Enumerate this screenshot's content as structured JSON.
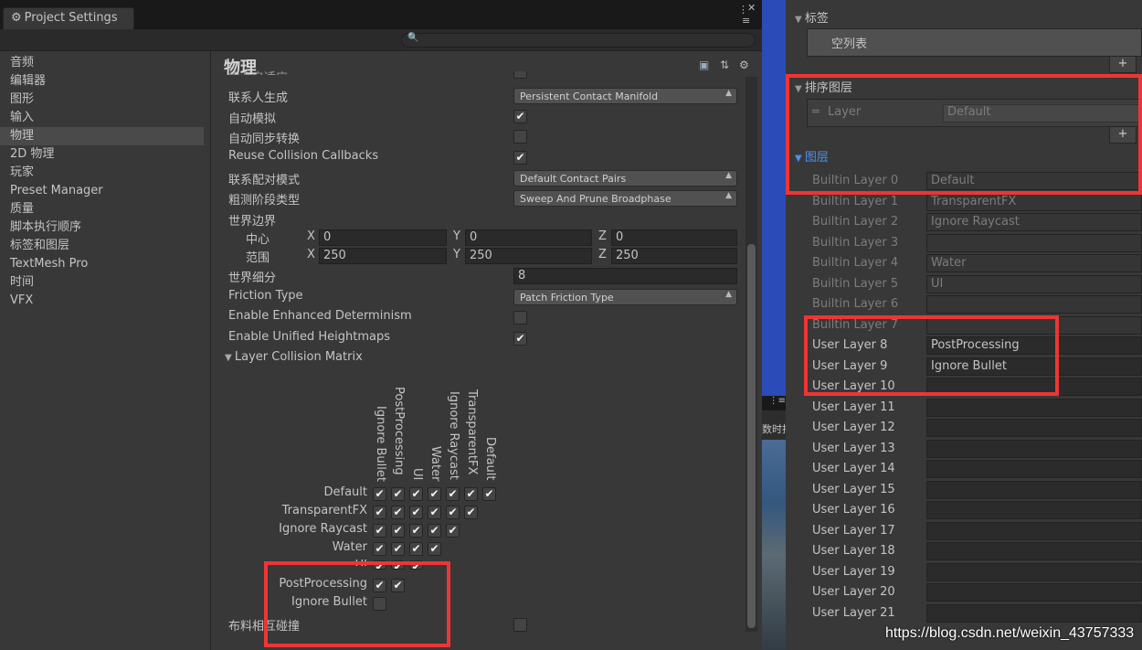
{
  "window": {
    "title": "Project Settings",
    "search_placeholder": ""
  },
  "sidebar": {
    "items": [
      "音频",
      "编辑器",
      "图形",
      "输入",
      "物理",
      "2D 物理",
      "玩家",
      "Preset Manager",
      "质量",
      "脚本执行顺序",
      "标签和图层",
      "TextMesh Pro",
      "时间",
      "VFX"
    ],
    "selected": "物理"
  },
  "physics": {
    "title": "物理",
    "hidden_row_label": "检测自适应",
    "contact_gen_label": "联系人生成",
    "contact_gen_value": "Persistent Contact Manifold",
    "auto_simulate_label": "自动模拟",
    "auto_simulate": true,
    "auto_sync_label": "自动同步转换",
    "auto_sync": false,
    "reuse_callbacks_label": "Reuse Collision Callbacks",
    "reuse_callbacks": true,
    "contact_pairs_label": "联系配对模式",
    "contact_pairs_value": "Default Contact Pairs",
    "broadphase_label": "粗测阶段类型",
    "broadphase_value": "Sweep And Prune Broadphase",
    "world_bounds_label": "世界边界",
    "center_label": "中心",
    "center": {
      "x": "0",
      "y": "0",
      "z": "0"
    },
    "extent_label": "范围",
    "extent": {
      "x": "250",
      "y": "250",
      "z": "250"
    },
    "axis_x": "X",
    "axis_y": "Y",
    "axis_z": "Z",
    "subdivisions_label": "世界细分",
    "subdivisions": "8",
    "friction_label": "Friction Type",
    "friction_value": "Patch Friction Type",
    "determinism_label": "Enable Enhanced Determinism",
    "determinism": false,
    "heightmaps_label": "Enable Unified Heightmaps",
    "heightmaps": true,
    "matrix_label": "Layer Collision Matrix",
    "cloth_label": "布料相互碰撞",
    "cloth": false
  },
  "matrix": {
    "columns": [
      "Ignore Bullet",
      "PostProcessing",
      "UI",
      "Water",
      "Ignore Raycast",
      "TransparentFX",
      "Default"
    ],
    "rows": [
      {
        "label": "Default",
        "checks": [
          true,
          true,
          true,
          true,
          true,
          true,
          true
        ]
      },
      {
        "label": "TransparentFX",
        "checks": [
          true,
          true,
          true,
          true,
          true,
          true
        ]
      },
      {
        "label": "Ignore Raycast",
        "checks": [
          true,
          true,
          true,
          true,
          true
        ]
      },
      {
        "label": "Water",
        "checks": [
          true,
          true,
          true,
          true
        ]
      },
      {
        "label": "UI",
        "checks": [
          true,
          true,
          true
        ]
      },
      {
        "label": "PostProcessing",
        "checks": [
          true,
          true
        ]
      },
      {
        "label": "Ignore Bullet",
        "checks": [
          false
        ]
      }
    ]
  },
  "tags": {
    "section_label": "标签",
    "empty_list": "空列表",
    "plus": "+",
    "sorting_label": "排序图层",
    "sorting_row_label": "Layer",
    "sorting_row_value": "Default",
    "layers_label": "图层",
    "layers": [
      {
        "name": "Builtin Layer 0",
        "value": "Default",
        "builtin": true
      },
      {
        "name": "Builtin Layer 1",
        "value": "TransparentFX",
        "builtin": true
      },
      {
        "name": "Builtin Layer 2",
        "value": "Ignore Raycast",
        "builtin": true
      },
      {
        "name": "Builtin Layer 3",
        "value": "",
        "builtin": true
      },
      {
        "name": "Builtin Layer 4",
        "value": "Water",
        "builtin": true
      },
      {
        "name": "Builtin Layer 5",
        "value": "UI",
        "builtin": true
      },
      {
        "name": "Builtin Layer 6",
        "value": "",
        "builtin": true
      },
      {
        "name": "Builtin Layer 7",
        "value": "",
        "builtin": true
      },
      {
        "name": "User Layer 8",
        "value": "PostProcessing",
        "builtin": false
      },
      {
        "name": "User Layer 9",
        "value": "Ignore Bullet",
        "builtin": false
      },
      {
        "name": "User Layer 10",
        "value": "",
        "builtin": false
      },
      {
        "name": "User Layer 11",
        "value": "",
        "builtin": false
      },
      {
        "name": "User Layer 12",
        "value": "",
        "builtin": false
      },
      {
        "name": "User Layer 13",
        "value": "",
        "builtin": false
      },
      {
        "name": "User Layer 14",
        "value": "",
        "builtin": false
      },
      {
        "name": "User Layer 15",
        "value": "",
        "builtin": false
      },
      {
        "name": "User Layer 16",
        "value": "",
        "builtin": false
      },
      {
        "name": "User Layer 17",
        "value": "",
        "builtin": false
      },
      {
        "name": "User Layer 18",
        "value": "",
        "builtin": false
      },
      {
        "name": "User Layer 19",
        "value": "",
        "builtin": false
      },
      {
        "name": "User Layer 20",
        "value": "",
        "builtin": false
      },
      {
        "name": "User Layer 21",
        "value": "",
        "builtin": false
      }
    ]
  },
  "middle": {
    "label": "数时报"
  },
  "watermark": "https://blog.csdn.net/weixin_43757333",
  "colors": {
    "highlight": "#ee3535",
    "accent": "#4d8fe8",
    "panel": "#383838"
  }
}
